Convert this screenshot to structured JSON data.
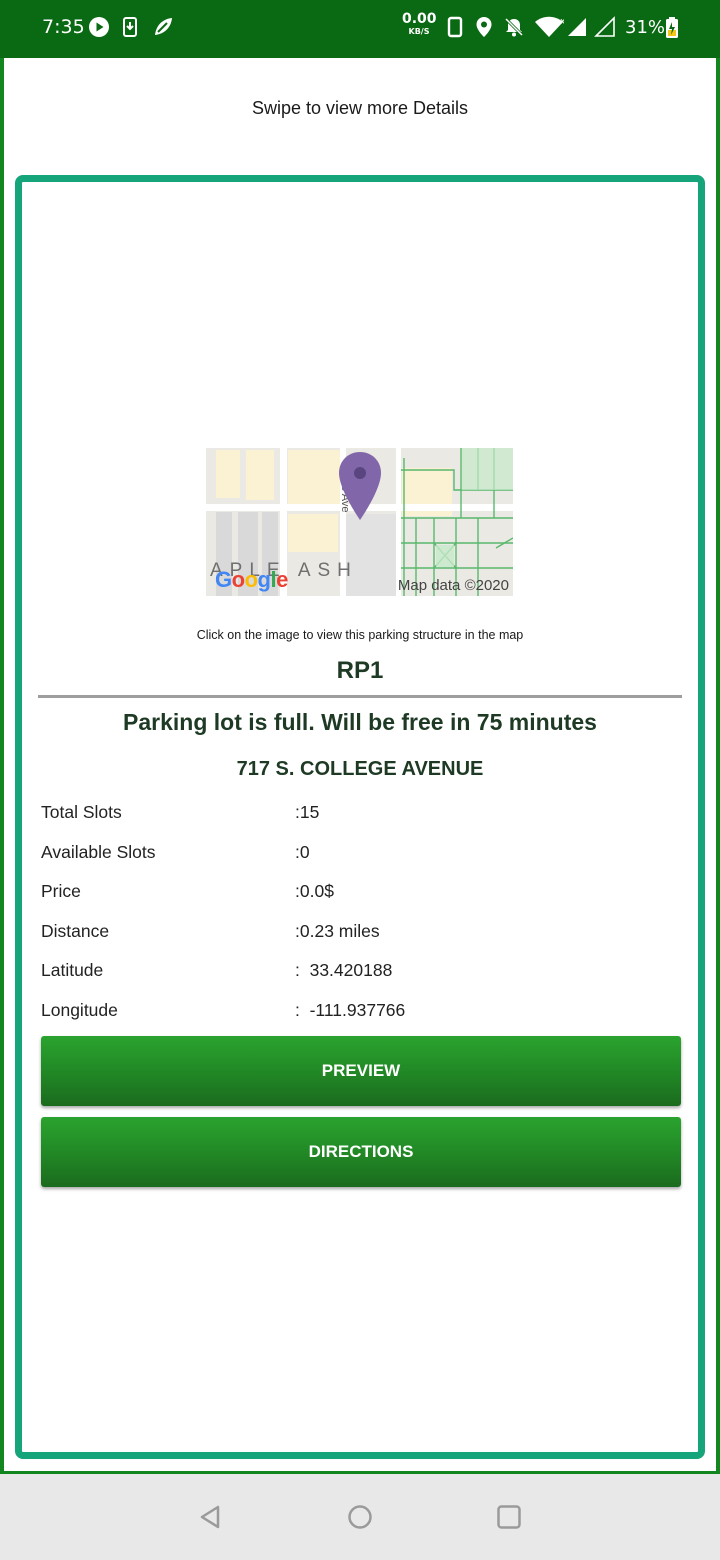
{
  "status_bar": {
    "time": "7:35",
    "net_speed_value": "0.00",
    "net_speed_unit": "KB/S",
    "battery": "31%"
  },
  "header": {
    "swipe_hint": "Swipe to view more Details"
  },
  "map": {
    "street_label": "rtle Ave",
    "area_label": "APLE ASH",
    "google_logo": "Google",
    "map_data": "Map data ©2020",
    "hint": "Click on the image to view this parking structure in the map"
  },
  "lot": {
    "name": "RP1",
    "status": "Parking lot is full. Will be free in 75 minutes",
    "address": "717 S. COLLEGE AVENUE"
  },
  "details": [
    {
      "label": "Total Slots",
      "value": ":15"
    },
    {
      "label": "Available Slots",
      "value": ":0"
    },
    {
      "label": "Price",
      "value": ":0.0$"
    },
    {
      "label": "Distance",
      "value": ":0.23 miles"
    },
    {
      "label": "Latitude",
      "value": ":  33.420188"
    },
    {
      "label": "Longitude",
      "value": ":  -111.937766"
    }
  ],
  "buttons": {
    "preview": "PREVIEW",
    "directions": "DIRECTIONS"
  },
  "colors": {
    "status_bar": "#0a6a14",
    "frame_border": "#12871f",
    "card_border": "#16a47a",
    "button_green": "#228c26",
    "text_dark_green": "#1e3a24",
    "nav_bar": "#e8e8e8"
  },
  "icons": {
    "status_left": [
      "play-circle-icon",
      "download-icon",
      "leaf-icon"
    ],
    "status_right": [
      "phone-icon",
      "location-pin-icon",
      "notifications-off-icon",
      "wifi-icon",
      "signal-icon",
      "signal-icon",
      "battery-charging-icon"
    ],
    "nav": [
      "back-icon",
      "home-icon",
      "recents-icon"
    ],
    "map": [
      "map-pin-icon"
    ]
  }
}
